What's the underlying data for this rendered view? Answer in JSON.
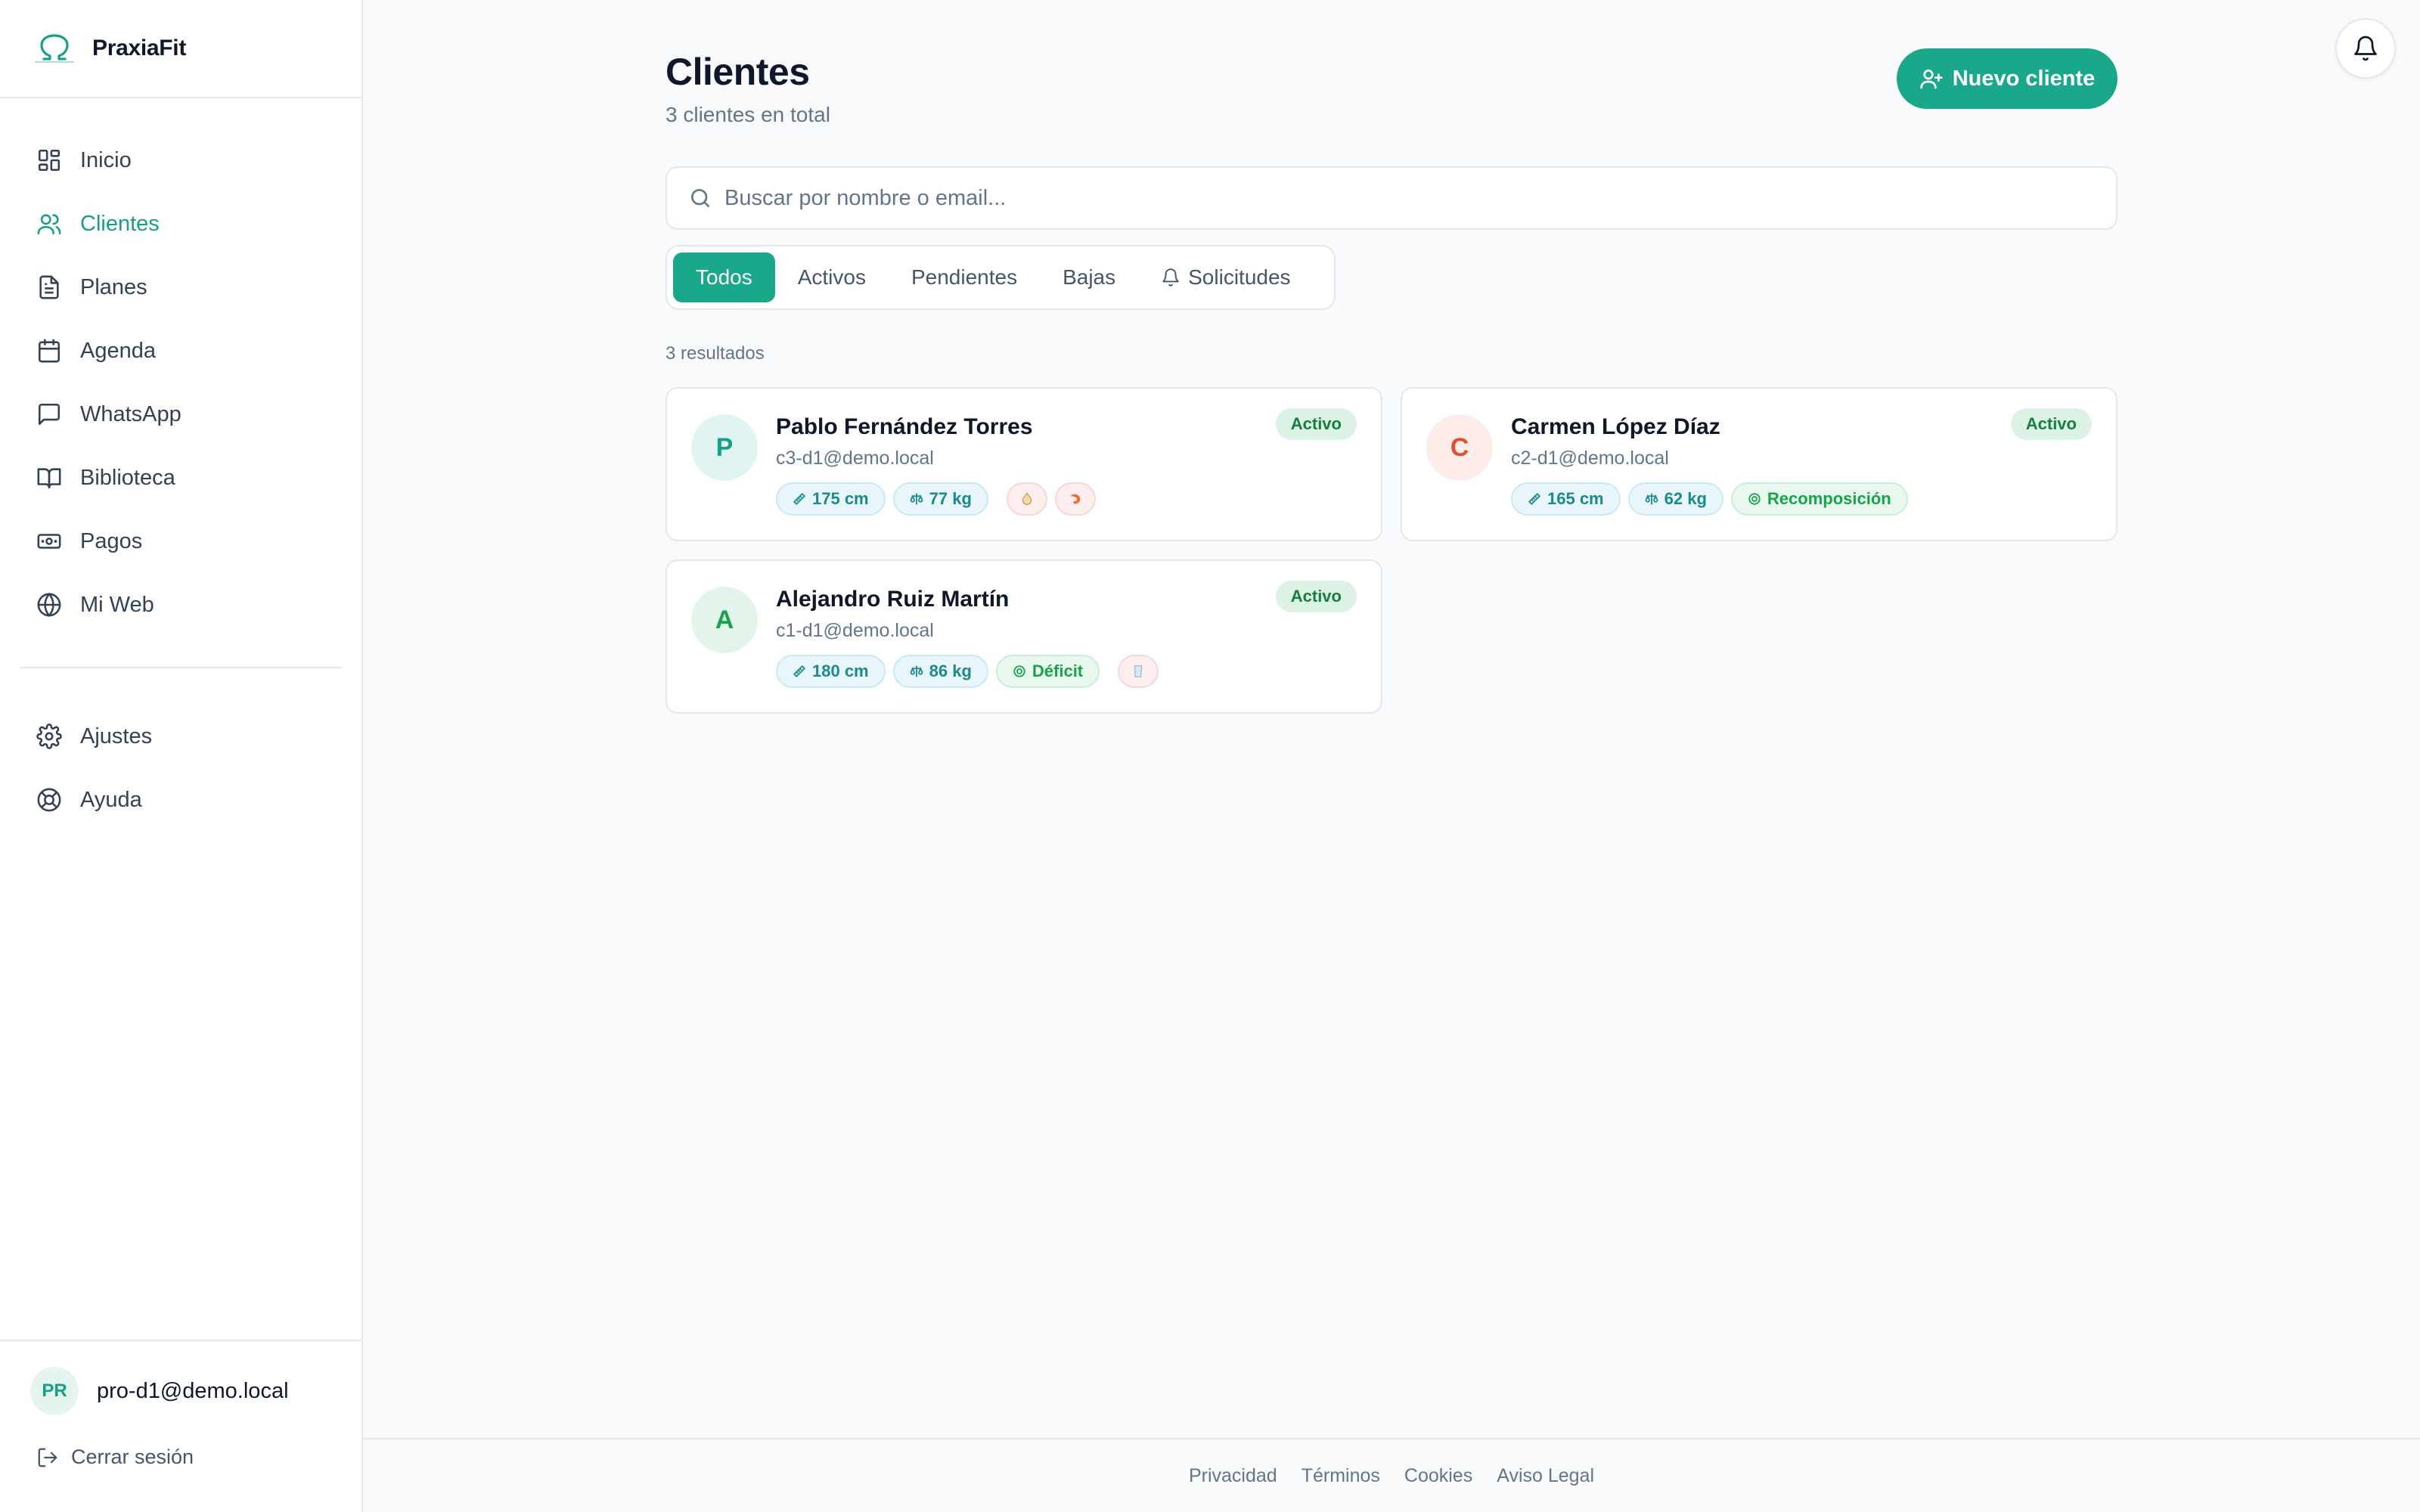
{
  "app": {
    "name": "PraxiaFit"
  },
  "sidebar": {
    "items": [
      {
        "label": "Inicio",
        "icon": "dashboard-icon"
      },
      {
        "label": "Clientes",
        "icon": "users-icon",
        "active": true
      },
      {
        "label": "Planes",
        "icon": "document-icon"
      },
      {
        "label": "Agenda",
        "icon": "calendar-icon"
      },
      {
        "label": "WhatsApp",
        "icon": "chat-icon"
      },
      {
        "label": "Biblioteca",
        "icon": "book-icon"
      },
      {
        "label": "Pagos",
        "icon": "banknote-icon"
      },
      {
        "label": "Mi Web",
        "icon": "globe-icon"
      }
    ],
    "secondary": [
      {
        "label": "Ajustes",
        "icon": "gear-icon"
      },
      {
        "label": "Ayuda",
        "icon": "lifebuoy-icon"
      }
    ],
    "user": {
      "initials": "PR",
      "email": "pro-d1@demo.local"
    },
    "logout_label": "Cerrar sesión"
  },
  "header": {
    "title": "Clientes",
    "subtitle": "3 clientes en total",
    "new_button": "Nuevo cliente"
  },
  "search": {
    "placeholder": "Buscar por nombre o email..."
  },
  "tabs": [
    "Todos",
    "Activos",
    "Pendientes",
    "Bajas",
    "Solicitudes"
  ],
  "results_label": "3 resultados",
  "clients": [
    {
      "initial": "P",
      "name": "Pablo Fernández Torres",
      "email": "c3-d1@demo.local",
      "status": "Activo",
      "height": "175 cm",
      "weight": "77 kg",
      "goal": "",
      "avatar_bg": "#e0f5f1",
      "avatar_color": "#16a085",
      "icons": [
        "garlic-icon",
        "shrimp-icon"
      ]
    },
    {
      "initial": "C",
      "name": "Carmen López Díaz",
      "email": "c2-d1@demo.local",
      "status": "Activo",
      "height": "165 cm",
      "weight": "62 kg",
      "goal": "Recomposición",
      "avatar_bg": "#fdecea",
      "avatar_color": "#e0502f",
      "icons": []
    },
    {
      "initial": "A",
      "name": "Alejandro Ruiz Martín",
      "email": "c1-d1@demo.local",
      "status": "Activo",
      "height": "180 cm",
      "weight": "86 kg",
      "goal": "Déficit",
      "avatar_bg": "#e3f5ea",
      "avatar_color": "#16a34a",
      "icons": [
        "milk-icon"
      ]
    }
  ],
  "footer": {
    "links": [
      "Privacidad",
      "Términos",
      "Cookies",
      "Aviso Legal"
    ]
  },
  "colors": {
    "accent": "#1aa88a",
    "status_bg": "#dcf2e5",
    "status_text": "#15803d"
  }
}
